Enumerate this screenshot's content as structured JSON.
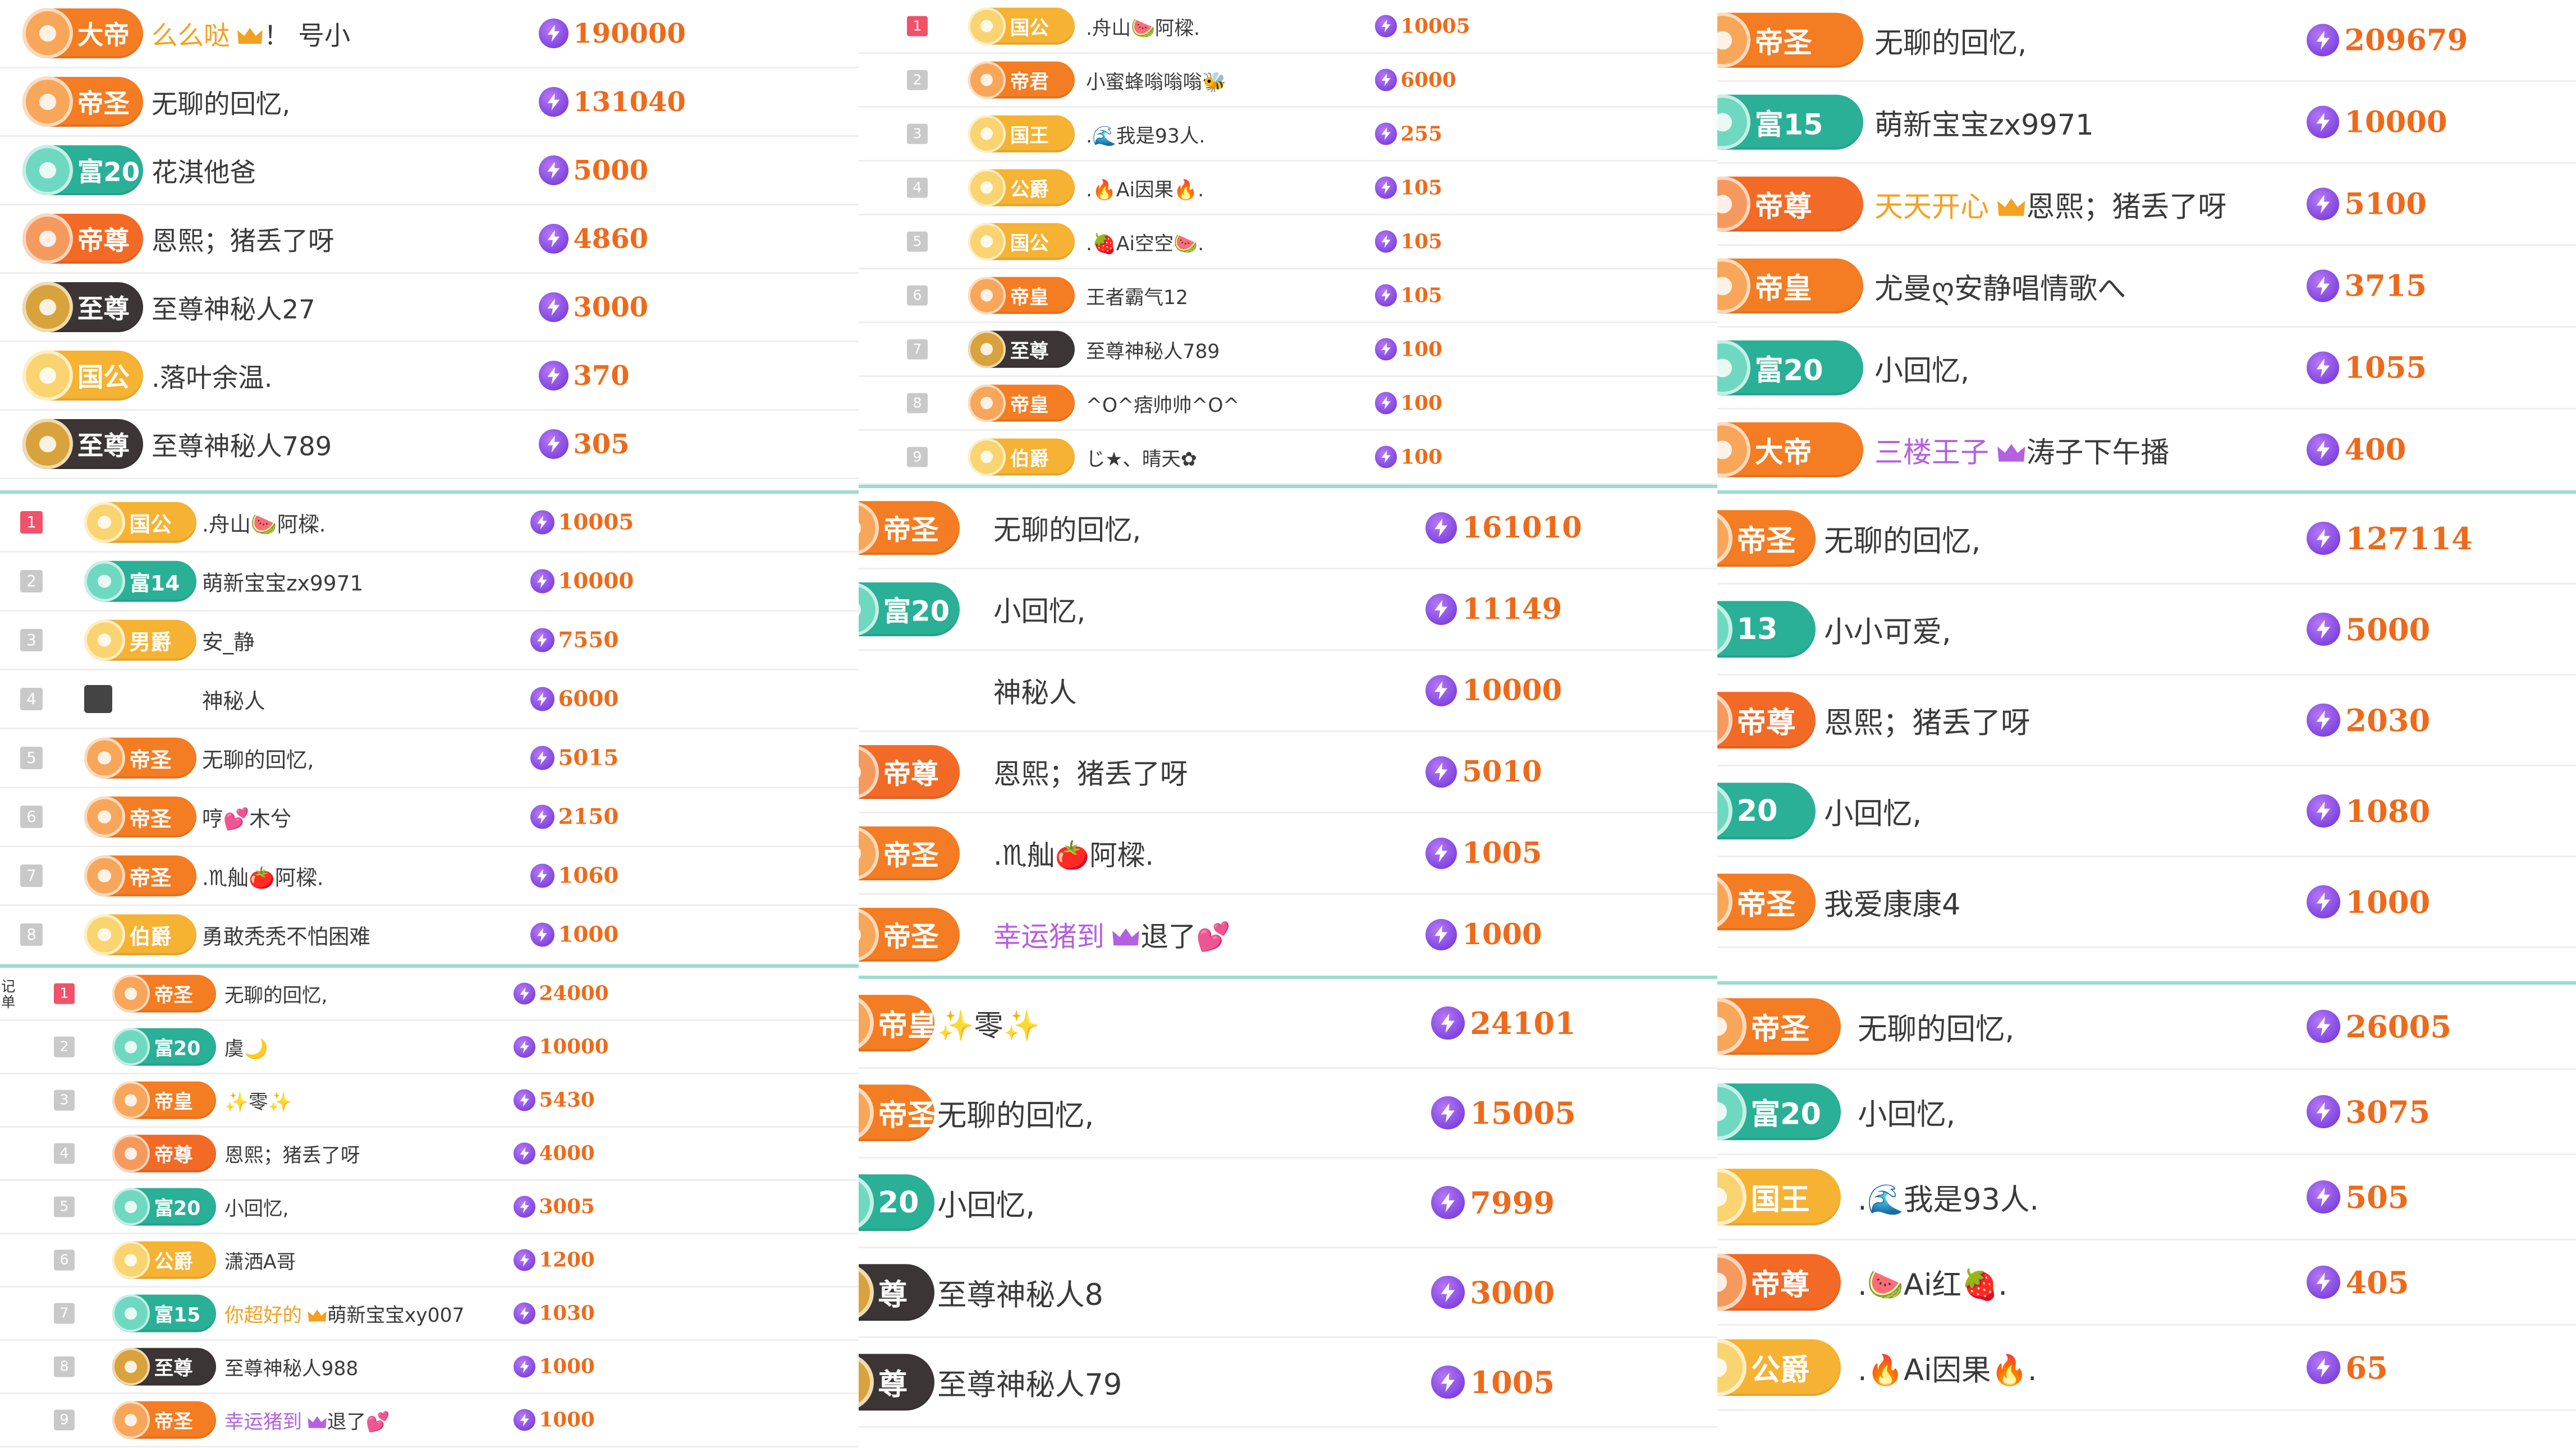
{
  "colors": {
    "score_text": "#ee6a1a",
    "bolt_icon": "#7b3fe4",
    "divider": "#9adcd0",
    "rank_first": "#f0526a",
    "rank_other": "#c9c9c9",
    "highlight_orange": "#f4a020",
    "highlight_purple": "#b560e0"
  },
  "badge_styles": {
    "帝圣": {
      "bg": "#f47c22",
      "emblem": "#f8a65a"
    },
    "帝尊": {
      "bg": "#f26a25",
      "emblem": "#f59a5e"
    },
    "帝皇": {
      "bg": "#f47c22",
      "emblem": "#f8a65a"
    },
    "帝君": {
      "bg": "#f47c22",
      "emblem": "#f8a65a"
    },
    "大帝": {
      "bg": "#f47c22",
      "emblem": "#f8a65a"
    },
    "国公": {
      "bg": "#f6b233",
      "emblem": "#f9d470"
    },
    "国王": {
      "bg": "#f6b233",
      "emblem": "#f9d470"
    },
    "公爵": {
      "bg": "#f6b233",
      "emblem": "#f9d470"
    },
    "伯爵": {
      "bg": "#f6b233",
      "emblem": "#f9d470"
    },
    "男爵": {
      "bg": "#f6b233",
      "emblem": "#f9d470"
    },
    "富": {
      "bg": "#29b096",
      "emblem": "#6fd8c0"
    },
    "至尊": {
      "bg": "#3b3536",
      "emblem": "#d8a23c"
    }
  },
  "panels": [
    {
      "id": "p1",
      "lists": [
        {
          "ranked": false,
          "rows": [
            {
              "badge": "大帝",
              "badge_type": "大帝",
              "highlight": "么么哒",
              "highlight_color": "#f4a020",
              "highlight_icon": "crown-icon",
              "name": "！ 号小",
              "score": "190000"
            },
            {
              "badge": "帝圣",
              "badge_type": "帝圣",
              "name": "无聊的回忆,",
              "score": "131040"
            },
            {
              "badge": "富20",
              "badge_type": "富",
              "name": "花淇他爸",
              "score": "5000"
            },
            {
              "badge": "帝尊",
              "badge_type": "帝尊",
              "name": "恩熙；猪丢了呀",
              "score": "4860"
            },
            {
              "badge": "至尊",
              "badge_type": "至尊",
              "name": "至尊神秘人27",
              "score": "3000"
            },
            {
              "badge": "国公",
              "badge_type": "国公",
              "name": ".落叶余温.",
              "score": "370"
            },
            {
              "badge": "至尊",
              "badge_type": "至尊",
              "name": "至尊神秘人789",
              "score": "305"
            }
          ]
        },
        {
          "ranked": true,
          "rows": [
            {
              "rank": "1",
              "badge": "国公",
              "badge_type": "国公",
              "name": ".舟山🍉阿樑.",
              "score": "10005"
            },
            {
              "rank": "2",
              "badge": "富14",
              "badge_type": "富",
              "name": "萌新宝宝zx9971",
              "score": "10000"
            },
            {
              "rank": "3",
              "badge": "男爵",
              "badge_type": "男爵",
              "name": "安_静",
              "score": "7550"
            },
            {
              "rank": "4",
              "badge": "",
              "badge_type": "mystic",
              "name": "神秘人",
              "score": "6000"
            },
            {
              "rank": "5",
              "badge": "帝圣",
              "badge_type": "帝圣",
              "name": "无聊的回忆,",
              "score": "5015"
            },
            {
              "rank": "6",
              "badge": "帝圣",
              "badge_type": "帝圣",
              "name": "哼💕木兮",
              "score": "2150"
            },
            {
              "rank": "7",
              "badge": "帝圣",
              "badge_type": "帝圣",
              "name": ".♏舢🍅阿樑.",
              "score": "1060"
            },
            {
              "rank": "8",
              "badge": "伯爵",
              "badge_type": "伯爵",
              "name": "勇敢秃秃不怕困难",
              "score": "1000"
            }
          ]
        },
        {
          "ranked": true,
          "edge_text": "记\n单",
          "rows": [
            {
              "rank": "1",
              "badge": "帝圣",
              "badge_type": "帝圣",
              "name": "无聊的回忆,",
              "score": "24000"
            },
            {
              "rank": "2",
              "badge": "富20",
              "badge_type": "富",
              "name": "虞🌙",
              "score": "10000"
            },
            {
              "rank": "3",
              "badge": "帝皇",
              "badge_type": "帝皇",
              "name": "✨零✨",
              "score": "5430"
            },
            {
              "rank": "4",
              "badge": "帝尊",
              "badge_type": "帝尊",
              "name": "恩熙；猪丢了呀",
              "score": "4000"
            },
            {
              "rank": "5",
              "badge": "富20",
              "badge_type": "富",
              "name": "小回忆,",
              "score": "3005"
            },
            {
              "rank": "6",
              "badge": "公爵",
              "badge_type": "公爵",
              "name": "潇洒A哥",
              "score": "1200"
            },
            {
              "rank": "7",
              "badge": "富15",
              "badge_type": "富",
              "highlight": "你超好的",
              "highlight_color": "#f4a020",
              "highlight_icon": "crown-icon",
              "name": "萌新宝宝xy007",
              "score": "1030"
            },
            {
              "rank": "8",
              "badge": "至尊",
              "badge_type": "至尊",
              "name": "至尊神秘人988",
              "score": "1000"
            },
            {
              "rank": "9",
              "badge": "帝圣",
              "badge_type": "帝圣",
              "highlight": "幸运猪到",
              "highlight_color": "#b560e0",
              "highlight_icon": "crown-icon",
              "name": "退了💕",
              "score": "1000"
            }
          ]
        }
      ]
    },
    {
      "id": "p2",
      "lists": [
        {
          "ranked": true,
          "rows": [
            {
              "rank": "1",
              "badge": "国公",
              "badge_type": "国公",
              "name": ".舟山🍉阿樑.",
              "score": "10005"
            },
            {
              "rank": "2",
              "badge": "帝君",
              "badge_type": "帝君",
              "name": "小蜜蜂嗡嗡嗡🐝",
              "score": "6000"
            },
            {
              "rank": "3",
              "badge": "国王",
              "badge_type": "国王",
              "name": ".🌊我是93人.",
              "score": "255"
            },
            {
              "rank": "4",
              "badge": "公爵",
              "badge_type": "公爵",
              "name": ".🔥Ai因果🔥.",
              "score": "105"
            },
            {
              "rank": "5",
              "badge": "国公",
              "badge_type": "国公",
              "name": ".🍓Ai空空🍉.",
              "score": "105"
            },
            {
              "rank": "6",
              "badge": "帝皇",
              "badge_type": "帝皇",
              "name": "王者霸气12",
              "score": "105"
            },
            {
              "rank": "7",
              "badge": "至尊",
              "badge_type": "至尊",
              "name": "至尊神秘人789",
              "score": "100"
            },
            {
              "rank": "8",
              "badge": "帝皇",
              "badge_type": "帝皇",
              "name": "^O^痞帅帅^O^",
              "score": "100"
            },
            {
              "rank": "9",
              "badge": "伯爵",
              "badge_type": "伯爵",
              "name": "じ★、晴天✿",
              "score": "100"
            }
          ]
        },
        {
          "ranked": false,
          "rows": [
            {
              "badge": "帝圣",
              "badge_type": "帝圣",
              "name": "无聊的回忆,",
              "score": "161010"
            },
            {
              "badge": "富20",
              "badge_type": "富",
              "name": "小回忆,",
              "score": "11149"
            },
            {
              "badge": "",
              "badge_type": "none",
              "name": "神秘人",
              "score": "10000"
            },
            {
              "badge": "帝尊",
              "badge_type": "帝尊",
              "name": "恩熙；猪丢了呀",
              "score": "5010"
            },
            {
              "badge": "帝圣",
              "badge_type": "帝圣",
              "name": ".♏舢🍅阿樑.",
              "score": "1005"
            },
            {
              "badge": "帝圣",
              "badge_type": "帝圣",
              "highlight": "幸运猪到",
              "highlight_color": "#b560e0",
              "highlight_icon": "crown-icon",
              "name": "退了💕",
              "score": "1000"
            }
          ]
        },
        {
          "ranked": false,
          "rows": [
            {
              "badge": "帝皇",
              "badge_type": "帝皇",
              "name": "✨零✨",
              "score": "24101"
            },
            {
              "badge": "帝圣",
              "badge_type": "帝圣",
              "name": "无聊的回忆,",
              "score": "15005"
            },
            {
              "badge": "20",
              "badge_type": "富",
              "name": "小回忆,",
              "score": "7999"
            },
            {
              "badge": "尊",
              "badge_type": "至尊",
              "name": "至尊神秘人8",
              "score": "3000"
            },
            {
              "badge": "尊",
              "badge_type": "至尊",
              "name": "至尊神秘人79",
              "score": "1005"
            }
          ]
        }
      ]
    },
    {
      "id": "p3",
      "lists": [
        {
          "ranked": false,
          "rows": [
            {
              "badge": "帝圣",
              "badge_type": "帝圣",
              "name": "无聊的回忆,",
              "score": "209679"
            },
            {
              "badge": "富15",
              "badge_type": "富",
              "name": "萌新宝宝zx9971",
              "score": "10000"
            },
            {
              "badge": "帝尊",
              "badge_type": "帝尊",
              "highlight": "天天开心",
              "highlight_color": "#f4a020",
              "highlight_icon": "crown-icon",
              "name": "恩熙；猪丢了呀",
              "score": "5100"
            },
            {
              "badge": "帝皇",
              "badge_type": "帝皇",
              "name": "尤曼ღ安静唱情歌へ",
              "score": "3715"
            },
            {
              "badge": "富20",
              "badge_type": "富",
              "name": "小回忆,",
              "score": "1055"
            },
            {
              "badge": "大帝",
              "badge_type": "大帝",
              "highlight": "三楼王子",
              "highlight_color": "#b560e0",
              "highlight_icon": "crown-icon",
              "name": "涛子下午播",
              "score": "400"
            }
          ]
        },
        {
          "ranked": false,
          "rows": [
            {
              "badge": "帝圣",
              "badge_type": "帝圣",
              "name": "无聊的回忆,",
              "score": "127114"
            },
            {
              "badge": "13",
              "badge_type": "富",
              "name": "小小可爱,",
              "score": "5000"
            },
            {
              "badge": "帝尊",
              "badge_type": "帝尊",
              "name": "恩熙；猪丢了呀",
              "score": "2030"
            },
            {
              "badge": "20",
              "badge_type": "富",
              "name": "小回忆,",
              "score": "1080"
            },
            {
              "badge": "帝圣",
              "badge_type": "帝圣",
              "name": "我爱康康4",
              "score": "1000"
            }
          ]
        },
        {
          "ranked": false,
          "rows": [
            {
              "badge": "帝圣",
              "badge_type": "帝圣",
              "name": "无聊的回忆,",
              "score": "26005"
            },
            {
              "badge": "富20",
              "badge_type": "富",
              "name": "小回忆,",
              "score": "3075"
            },
            {
              "badge": "国王",
              "badge_type": "国王",
              "name": ".🌊我是93人.",
              "score": "505"
            },
            {
              "badge": "帝尊",
              "badge_type": "帝尊",
              "name": ".🍉Ai红🍓.",
              "score": "405"
            },
            {
              "badge": "公爵",
              "badge_type": "公爵",
              "name": ".🔥Ai因果🔥.",
              "score": "65"
            }
          ]
        }
      ]
    }
  ]
}
